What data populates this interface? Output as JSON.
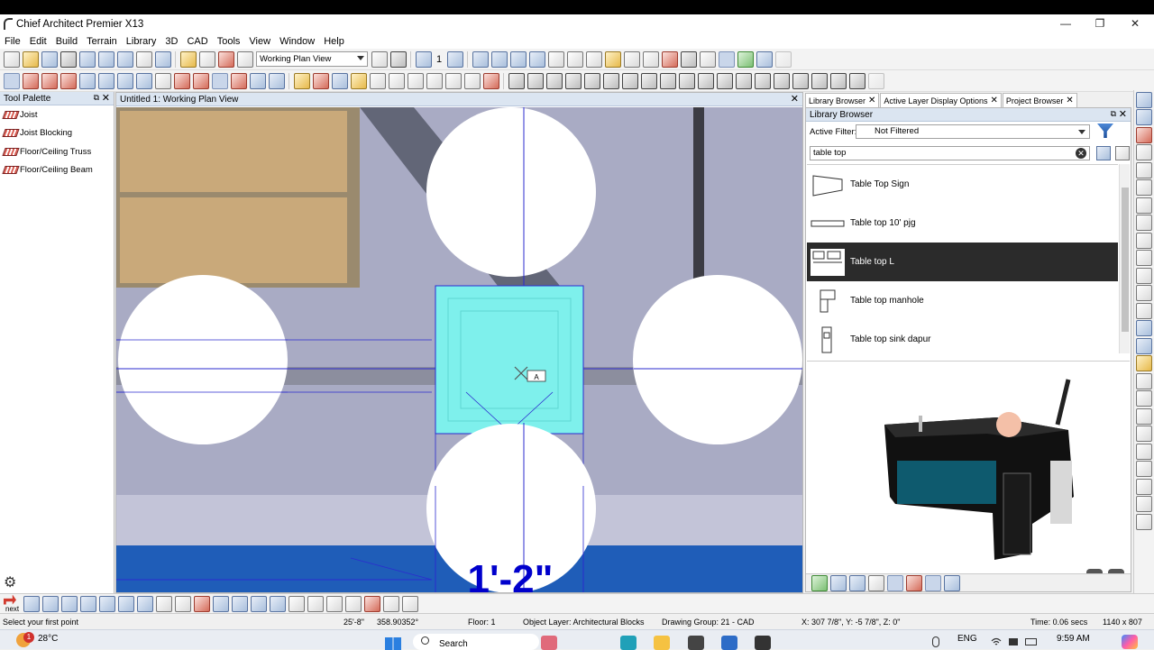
{
  "window": {
    "title": "Chief Architect Premier X13",
    "minimize": "—",
    "maximize": "❐",
    "close": "✕"
  },
  "menu": [
    "File",
    "Edit",
    "Build",
    "Terrain",
    "Library",
    "3D",
    "CAD",
    "Tools",
    "View",
    "Window",
    "Help"
  ],
  "toolbar": {
    "view_select": "Working Plan View",
    "floor_number": "1"
  },
  "tool_palette": {
    "title": "Tool Palette",
    "items": [
      "Joist",
      "Joist Blocking",
      "Floor/Ceiling Truss",
      "Floor/Ceiling Beam"
    ]
  },
  "document": {
    "title": "Untitled 1:  Working Plan View",
    "dimension_label": "1'-2\"",
    "marker_label": "A"
  },
  "right_tabs": [
    {
      "label": "Library Browser"
    },
    {
      "label": "Active Layer Display Options"
    },
    {
      "label": "Project Browser"
    }
  ],
  "library": {
    "title": "Library Browser",
    "filter_label": "Active Filter:",
    "filter_value": "Not Filtered",
    "search_value": "table top",
    "items": [
      {
        "label": "Table Top Sign",
        "selected": false
      },
      {
        "label": "Table top 10' pjg",
        "selected": false
      },
      {
        "label": "Table top L",
        "selected": true
      },
      {
        "label": "Table top manhole",
        "selected": false
      },
      {
        "label": "Table top sink dapur",
        "selected": false
      }
    ]
  },
  "status": {
    "prompt": "Select your first point",
    "length": "25'-8\"",
    "angle": "358.90352°",
    "floor": "Floor: 1",
    "layer": "Object Layer: Architectural Blocks",
    "drawing_group": "Drawing Group: 21 - CAD",
    "coords": "X: 307 7/8\", Y: -5 7/8\", Z: 0\"",
    "time": "Time: 0.06 secs",
    "resolution": "1140 x 807"
  },
  "bottom_toolbar": {
    "next_label": "next"
  },
  "taskbar": {
    "weather_temp": "28°C",
    "weather_badge": "1",
    "search_label": "Search",
    "language": "ENG",
    "clock": "9:59 AM"
  },
  "colors": {
    "selection": "#7ef0ec",
    "guide_line": "#2b2bcf",
    "dimension_text": "#0000cc",
    "selected_row": "#2b2b2b"
  }
}
